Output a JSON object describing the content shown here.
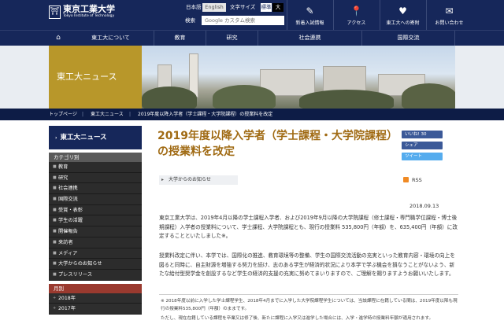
{
  "header": {
    "logo_mark": "⛩",
    "logo_jp": "東京工業大学",
    "logo_en": "Tokyo Institute of Technology",
    "lang_jp": "日本語",
    "lang_en": "English",
    "size_label": "文字サイズ",
    "size_std": "標準",
    "size_large": "大",
    "search_label": "検索",
    "search_placeholder": "Google カスタム検索",
    "links": [
      {
        "icon": "✎",
        "label": "新着入試情報"
      },
      {
        "icon": "📍",
        "label": "アクセス"
      },
      {
        "icon": "♥",
        "label": "東工大への寄附"
      },
      {
        "icon": "✉",
        "label": "お問い合わせ"
      }
    ]
  },
  "nav": {
    "home_icon": "⌂",
    "items": [
      "東工大について",
      "教育",
      "研究",
      "社会連携",
      "国際交流"
    ]
  },
  "hero": {
    "title": "東工大ニュース"
  },
  "breadcrumb": [
    "トップページ",
    "東工大ニュース",
    "2019年度以降入学者（学士課程・大学院課程）の授業料を改定"
  ],
  "sidebar": {
    "title": "東工大ニュース",
    "category_heading": "カテゴリ別",
    "categories": [
      "教育",
      "研究",
      "社会連携",
      "国際交流",
      "受賞・表彰",
      "学生の活躍",
      "開催報告",
      "来訪者",
      "メディア",
      "大学からのお知らせ",
      "プレスリリース"
    ],
    "month_heading": "月別",
    "months": [
      "2018年",
      "2017年"
    ]
  },
  "article": {
    "title": "2019年度以降入学者（学士課程・大学院課程）の授業料を改定",
    "social": {
      "like": "いいね! 30",
      "share": "シェア",
      "tweet": "ツイート"
    },
    "tag": "大学からのお知らせ",
    "rss": "RSS",
    "date": "2018.09.13",
    "para1": "東京工業大学は、2019年4月以降の学士課程入学者、および2019年9月以降の大学院課程（修士課程・専門職学位課程・博士後期課程）入学者の授業料について、学士課程、大学院課程とも、現行の授業料 535,800円（年額）を、635,400円（年額）に改定することといたしました※。",
    "para2": "授業料改定に伴い、本学では、国際化の推進、教育環境等の整備、学生の国際交流活動の充実といった教育内容・環境の向上を図ると同時に、自主財源を増強する努力を続け、志のある学生が経済的状況により本学で学ぶ機会を損なうことがないよう、新たな給付型奨学金を創設するなど学生の経済的支援の充実に努めてまいりますので、ご理解を賜りますようお願いいたします。",
    "note1": "※ 2018年度以前に入学した学士課程学生、2018年4月までに入学した大学院課程学生については、当該課程に在籍している間は、2019年度以降も現行の授業料535,800円（年額）のままです。",
    "note2": "ただし、現在在籍している課程を卒業又は修了後、新たに課程に入学又は進学した場合には、入学・進学時の授業料年額が適用されます。"
  }
}
